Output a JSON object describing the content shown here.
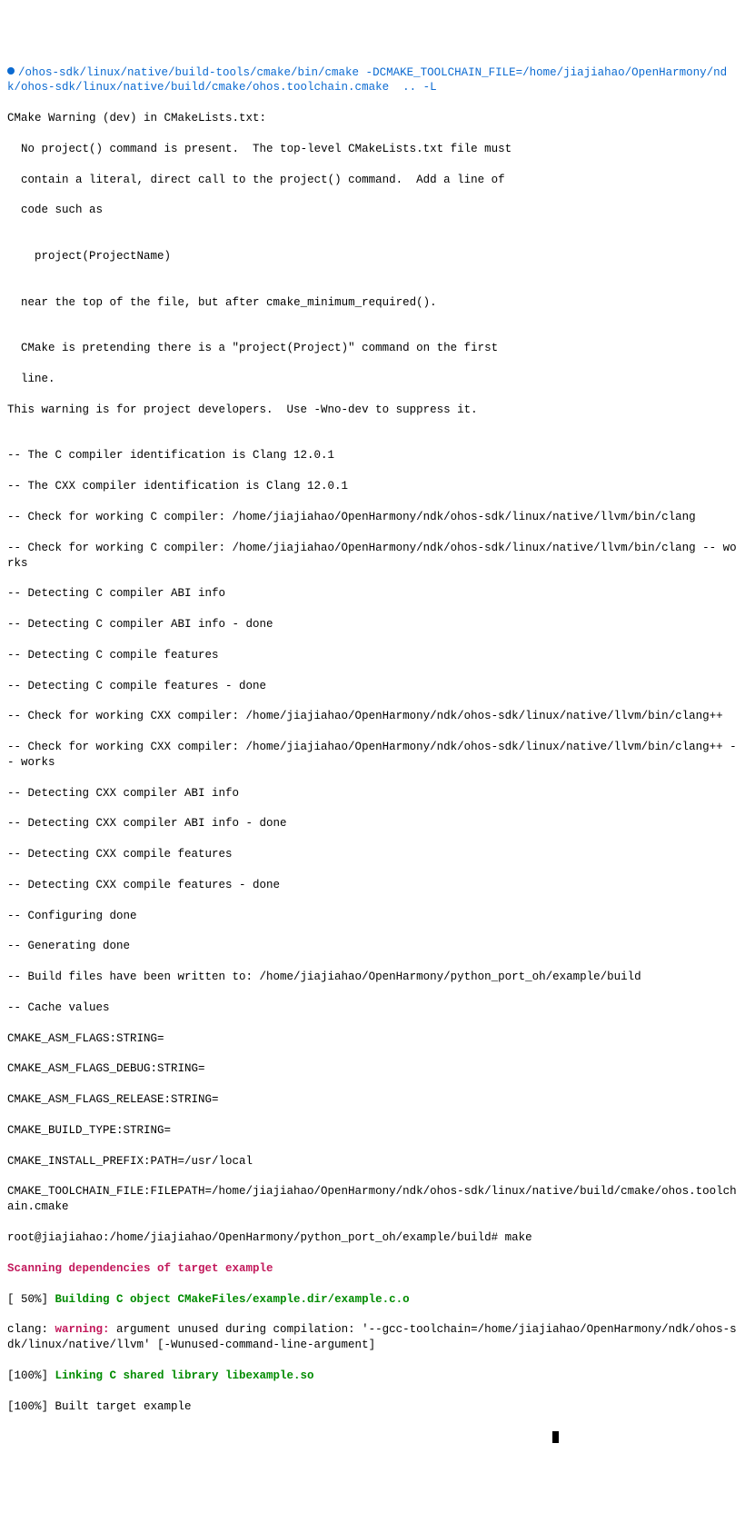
{
  "cmd": {
    "cmake_path": "/ohos-sdk/linux/native/build-tools/cmake/bin/cmake -DCMAKE_TOOLCHAIN_FILE=/home/jiajiahao/OpenHarmony/ndk/ohos-sdk/linux/native/build/cmake/ohos.toolchain.cmake  .. -L"
  },
  "warning": {
    "head": "CMake Warning (dev) in CMakeLists.txt:",
    "l1": "  No project() command is present.  The top-level CMakeLists.txt file must",
    "l2": "  contain a literal, direct call to the project() command.  Add a line of",
    "l3": "  code such as",
    "blank1": "",
    "l4": "    project(ProjectName)",
    "blank2": "",
    "l5": "  near the top of the file, but after cmake_minimum_required().",
    "blank3": "",
    "l6": "  CMake is pretending there is a \"project(Project)\" command on the first",
    "l7": "  line.",
    "l8": "This warning is for project developers.  Use -Wno-dev to suppress it.",
    "blank4": ""
  },
  "cfg": {
    "l01": "-- The C compiler identification is Clang 12.0.1",
    "l02": "-- The CXX compiler identification is Clang 12.0.1",
    "l03": "-- Check for working C compiler: /home/jiajiahao/OpenHarmony/ndk/ohos-sdk/linux/native/llvm/bin/clang",
    "l04": "-- Check for working C compiler: /home/jiajiahao/OpenHarmony/ndk/ohos-sdk/linux/native/llvm/bin/clang -- works",
    "l05": "-- Detecting C compiler ABI info",
    "l06": "-- Detecting C compiler ABI info - done",
    "l07": "-- Detecting C compile features",
    "l08": "-- Detecting C compile features - done",
    "l09": "-- Check for working CXX compiler: /home/jiajiahao/OpenHarmony/ndk/ohos-sdk/linux/native/llvm/bin/clang++",
    "l10": "-- Check for working CXX compiler: /home/jiajiahao/OpenHarmony/ndk/ohos-sdk/linux/native/llvm/bin/clang++ -- works",
    "l11": "-- Detecting CXX compiler ABI info",
    "l12": "-- Detecting CXX compiler ABI info - done",
    "l13": "-- Detecting CXX compile features",
    "l14": "-- Detecting CXX compile features - done",
    "l15": "-- Configuring done",
    "l16": "-- Generating done",
    "l17": "-- Build files have been written to: /home/jiajiahao/OpenHarmony/python_port_oh/example/build",
    "l18": "-- Cache values"
  },
  "cache": {
    "l1": "CMAKE_ASM_FLAGS:STRING=",
    "l2": "CMAKE_ASM_FLAGS_DEBUG:STRING=",
    "l3": "CMAKE_ASM_FLAGS_RELEASE:STRING=",
    "l4": "CMAKE_BUILD_TYPE:STRING=",
    "l5": "CMAKE_INSTALL_PREFIX:PATH=/usr/local",
    "l6": "CMAKE_TOOLCHAIN_FILE:FILEPATH=/home/jiajiahao/OpenHarmony/ndk/ohos-sdk/linux/native/build/cmake/ohos.toolchain.cmake"
  },
  "prompt2": "root@jiajiahao:/home/jiajiahao/OpenHarmony/python_port_oh/example/build# make",
  "build": {
    "scan": "Scanning dependencies of target example",
    "p50_prefix": "[ 50%] ",
    "p50_green": "Building C object CMakeFiles/example.dir/example.c.o",
    "clang_pre": "clang: ",
    "clang_warn": "warning:",
    "clang_msg": " argument unused during compilation: '--gcc-toolchain=/home/jiajiahao/OpenHarmony/ndk/ohos-sdk/linux/native/llvm' [-Wunused-command-line-argument]",
    "p100a_prefix": "[100%] ",
    "p100a_green": "Linking C shared library libexample.so",
    "p100b": "[100%] Built target example"
  }
}
